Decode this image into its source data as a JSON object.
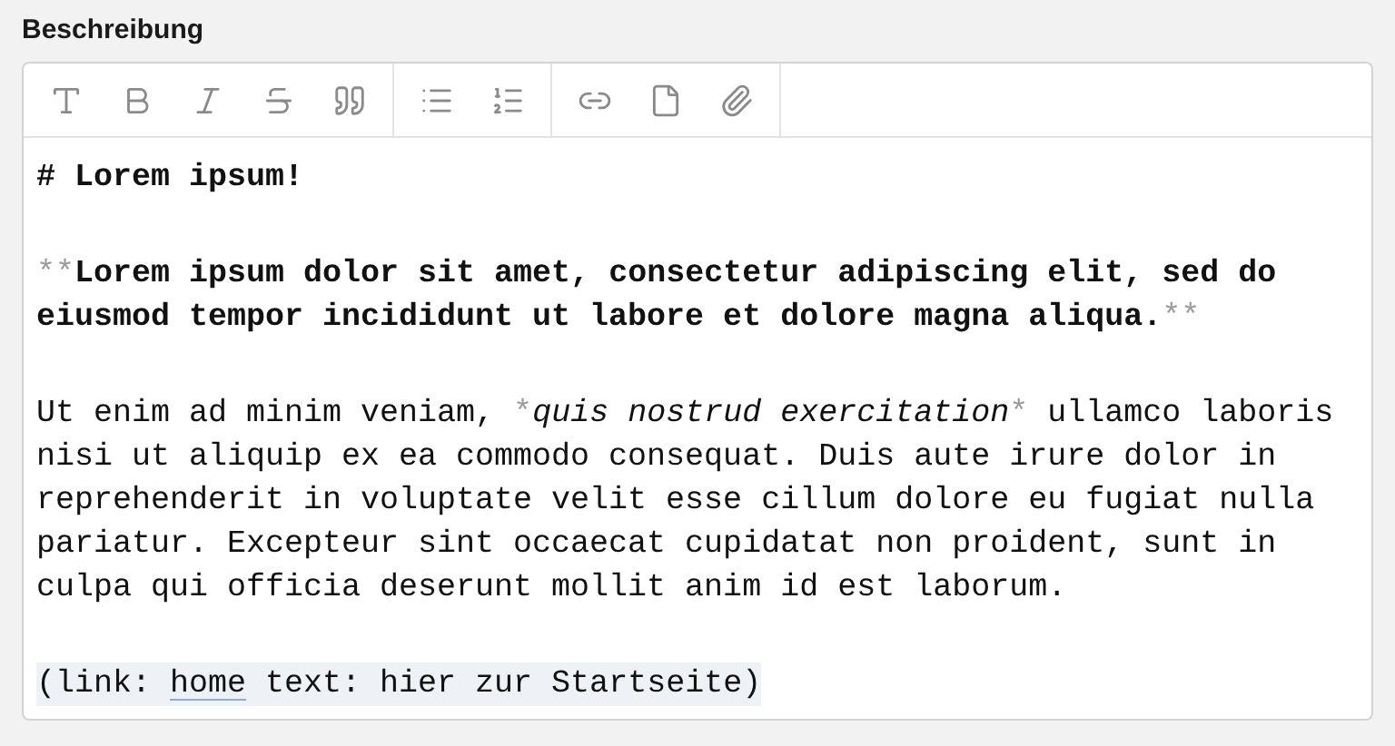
{
  "field_label": "Beschreibung",
  "toolbar": [
    [
      {
        "kind": "heading"
      },
      {
        "kind": "bold"
      },
      {
        "kind": "italic"
      },
      {
        "kind": "strike"
      },
      {
        "kind": "quote"
      }
    ],
    [
      {
        "kind": "bullets"
      },
      {
        "kind": "numbers"
      }
    ],
    [
      {
        "kind": "link"
      },
      {
        "kind": "file"
      },
      {
        "kind": "attach"
      }
    ]
  ],
  "paragraphs": [
    {
      "kind": "heading",
      "lines": [
        [
          {
            "kind": "text",
            "text": "# Lorem ipsum!"
          }
        ]
      ]
    },
    {
      "kind": "bold",
      "lines": [
        [
          {
            "kind": "marker",
            "text": "**"
          },
          {
            "kind": "text",
            "text": "Lorem ipsum dolor sit amet, consectetur adipiscing elit, sed do"
          }
        ],
        [
          {
            "kind": "text",
            "text": "eiusmod tempor incididunt ut labore et dolore magna aliqua."
          },
          {
            "kind": "marker",
            "text": "**"
          }
        ]
      ]
    },
    {
      "kind": "plain",
      "lines": [
        [
          {
            "kind": "text",
            "text": "Ut enim ad minim veniam, "
          },
          {
            "kind": "marker",
            "text": "*"
          },
          {
            "kind": "italic",
            "text": "quis nostrud exercitation"
          },
          {
            "kind": "marker",
            "text": "*"
          },
          {
            "kind": "text",
            "text": " ullamco laboris"
          }
        ],
        [
          {
            "kind": "text",
            "text": "nisi ut aliquip ex ea commodo consequat. Duis aute irure dolor in"
          }
        ],
        [
          {
            "kind": "text",
            "text": "reprehenderit in voluptate velit esse cillum dolore eu fugiat nulla"
          }
        ],
        [
          {
            "kind": "text",
            "text": "pariatur. Excepteur sint occaecat cupidatat non proident, sunt in"
          }
        ],
        [
          {
            "kind": "text",
            "text": "culpa qui officia deserunt mollit anim id est laborum."
          }
        ]
      ]
    },
    {
      "kind": "tag",
      "lines": [
        [
          {
            "kind": "text",
            "text": "(link: "
          },
          {
            "kind": "link",
            "text": "home"
          },
          {
            "kind": "text",
            "text": " text: hier zur Startseite)"
          }
        ]
      ]
    }
  ]
}
